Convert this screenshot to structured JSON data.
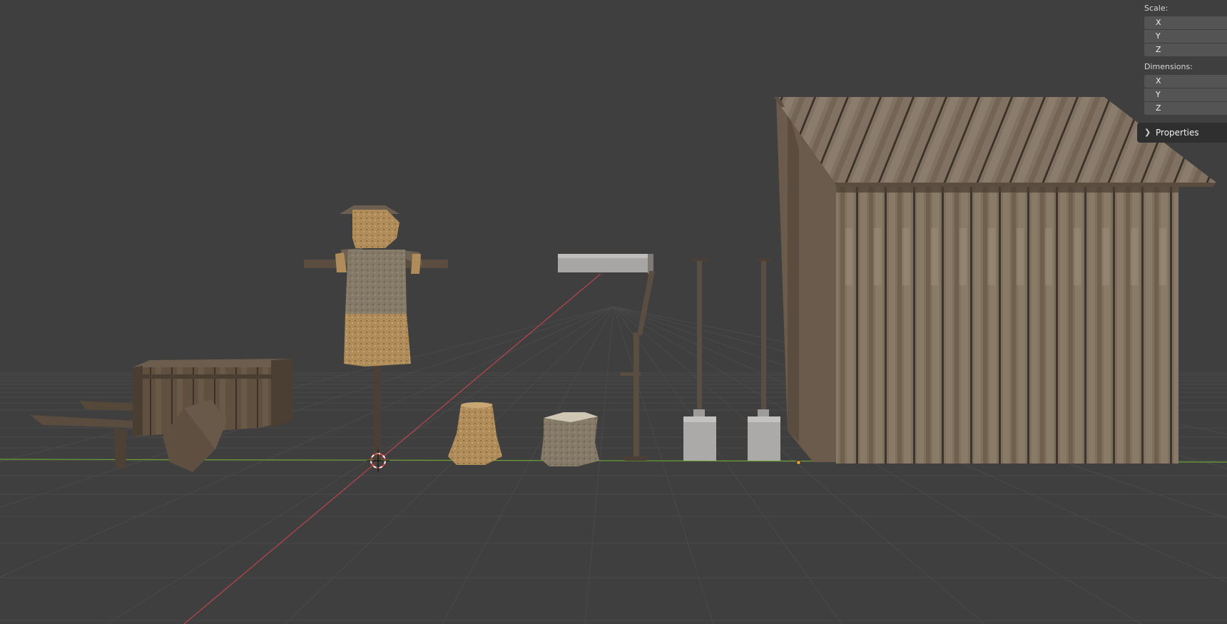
{
  "viewport": {
    "objects": [
      "wheelbarrow",
      "scarecrow",
      "grain-sack-small",
      "grain-sack-open",
      "signpost",
      "shovel-left",
      "shovel-right",
      "wooden-shed"
    ],
    "colors": {
      "background": "#3f3f3f",
      "grid": "#4b4b4b",
      "x_axis": "#b3454c",
      "y_axis": "#6aa033",
      "cursor": "#d84a3f",
      "origin": "#f0a030"
    }
  },
  "npanel": {
    "scale": {
      "label": "Scale:",
      "x": "X",
      "y": "Y",
      "z": "Z"
    },
    "dimensions": {
      "label": "Dimensions:",
      "x": "X",
      "y": "Y",
      "z": "Z"
    },
    "properties": {
      "label": "Properties",
      "icon": "chevron-right-icon"
    }
  }
}
